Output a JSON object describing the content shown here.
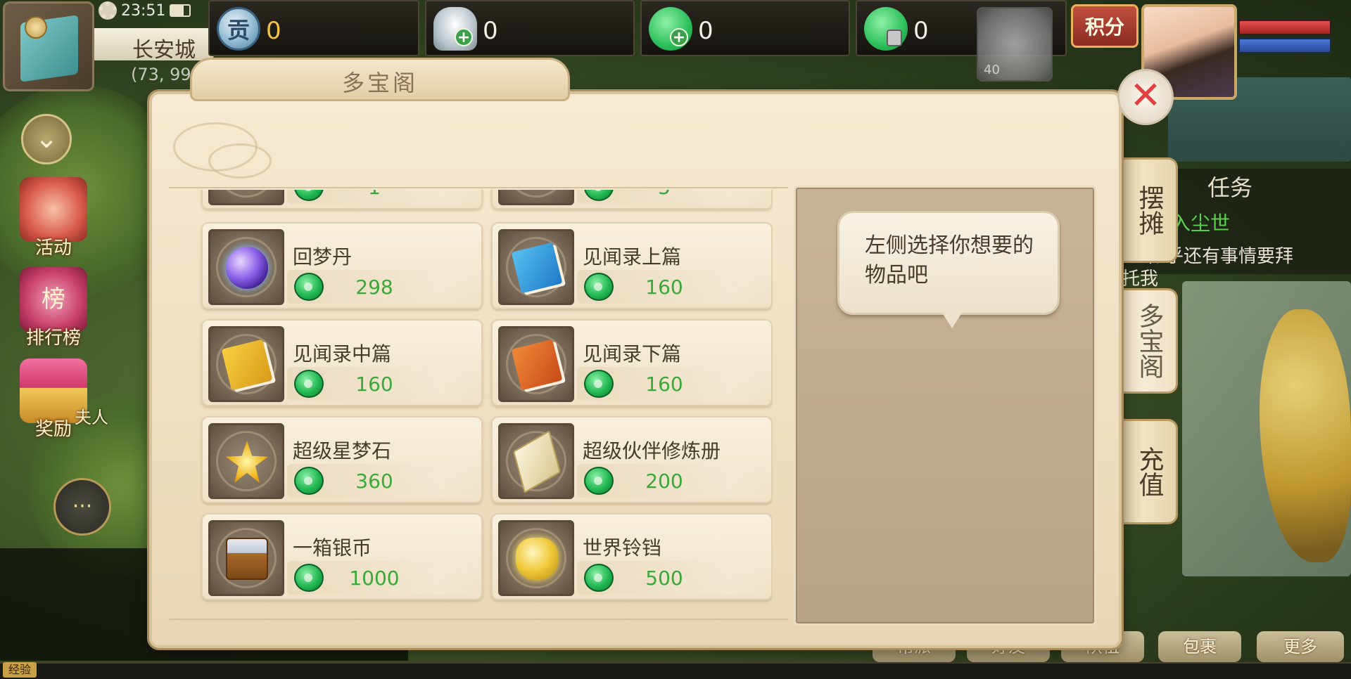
{
  "status": {
    "clock": "23:51"
  },
  "location": {
    "name": "长安城",
    "coords": "(73, 99"
  },
  "currencies": {
    "contribution": {
      "icon": "contribution-coin-icon",
      "glyph": "贡",
      "value": "0"
    },
    "silver": {
      "icon": "silver-ingot-icon",
      "value": "0"
    },
    "jade": {
      "icon": "jade-icon",
      "value": "0"
    },
    "bound_jade": {
      "icon": "locked-jade-icon",
      "value": "0"
    }
  },
  "pet": {
    "level": "40"
  },
  "score_button": {
    "label": "积分"
  },
  "side_buttons": {
    "activity": "活动",
    "ranking": "排行榜",
    "ranking_glyph": "榜",
    "reward": "奖励"
  },
  "npc_label": "夫人",
  "quest": {
    "title": "任务",
    "name": "初入尘世",
    "desc": "似乎还有事情要拜",
    "desc2": "托我"
  },
  "bottom_buttons": [
    "帮派",
    "好友",
    "队伍",
    "包裹",
    "更多"
  ],
  "exp_label": "经验",
  "shop": {
    "title": "多宝阁",
    "close_glyph": "✕",
    "tabs": {
      "stall": "摆摊",
      "shop": "多宝阁",
      "recharge": "充值"
    },
    "hint": "左侧选择你想要的物品吧",
    "partial_items": [
      {
        "value": "1"
      },
      {
        "value": "5"
      }
    ],
    "items": [
      {
        "name": "回梦丹",
        "price": "298",
        "icon": "dream-pill-icon"
      },
      {
        "name": "见闻录上篇",
        "price": "160",
        "icon": "blue-book-icon"
      },
      {
        "name": "见闻录中篇",
        "price": "160",
        "icon": "yellow-book-icon"
      },
      {
        "name": "见闻录下篇",
        "price": "160",
        "icon": "orange-book-icon"
      },
      {
        "name": "超级星梦石",
        "price": "360",
        "icon": "star-stone-icon"
      },
      {
        "name": "超级伙伴修炼册",
        "price": "200",
        "icon": "training-scroll-icon"
      },
      {
        "name": "一箱银币",
        "price": "1000",
        "icon": "silver-chest-icon"
      },
      {
        "name": "世界铃铛",
        "price": "500",
        "icon": "golden-bells-icon"
      }
    ]
  },
  "colors": {
    "price_green": "#3aa83a",
    "close_red": "#e04040",
    "dialog_bg": "#f6ead2"
  }
}
